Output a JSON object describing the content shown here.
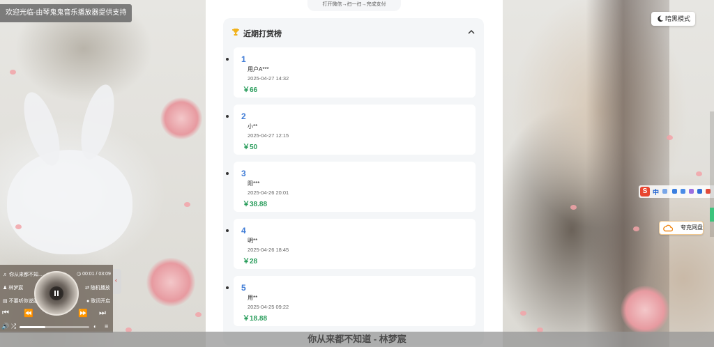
{
  "welcome": "欢迎光临-由琴鬼鬼音乐播放器提供支持",
  "qr_hint": "打开微信→扫一扫→完成支付",
  "board": {
    "title": "近期打赏榜",
    "entries": [
      {
        "rank": "1",
        "name": "用户A***",
        "date": "2025-04-27 14:32",
        "amount": "￥66"
      },
      {
        "rank": "2",
        "name": "小**",
        "date": "2025-04-27 12:15",
        "amount": "￥50"
      },
      {
        "rank": "3",
        "name": "阳***",
        "date": "2025-04-26 20:01",
        "amount": "￥38.88"
      },
      {
        "rank": "4",
        "name": "明**",
        "date": "2025-04-26 18:45",
        "amount": "￥28"
      },
      {
        "rank": "5",
        "name": "用**",
        "date": "2025-04-25 09:22",
        "amount": "￥18.88"
      }
    ]
  },
  "now_playing_bar": "你从来都不知道 - 林梦宸",
  "dark_mode_label": "暗黑模式",
  "ime": {
    "brand": "S",
    "lang": "中"
  },
  "quark_label": "夸克网盘",
  "player": {
    "song": "你从来都不知...",
    "time": "00:01 / 03:09",
    "artist": "林梦宸",
    "mode": "随机播放",
    "album": "不要听你说服",
    "lyrics": "歌词开启",
    "progress": 0.37
  },
  "colors": {
    "accent": "#3e7bd6",
    "amount": "#2a9d5c",
    "trophy": "#f1b21c"
  }
}
